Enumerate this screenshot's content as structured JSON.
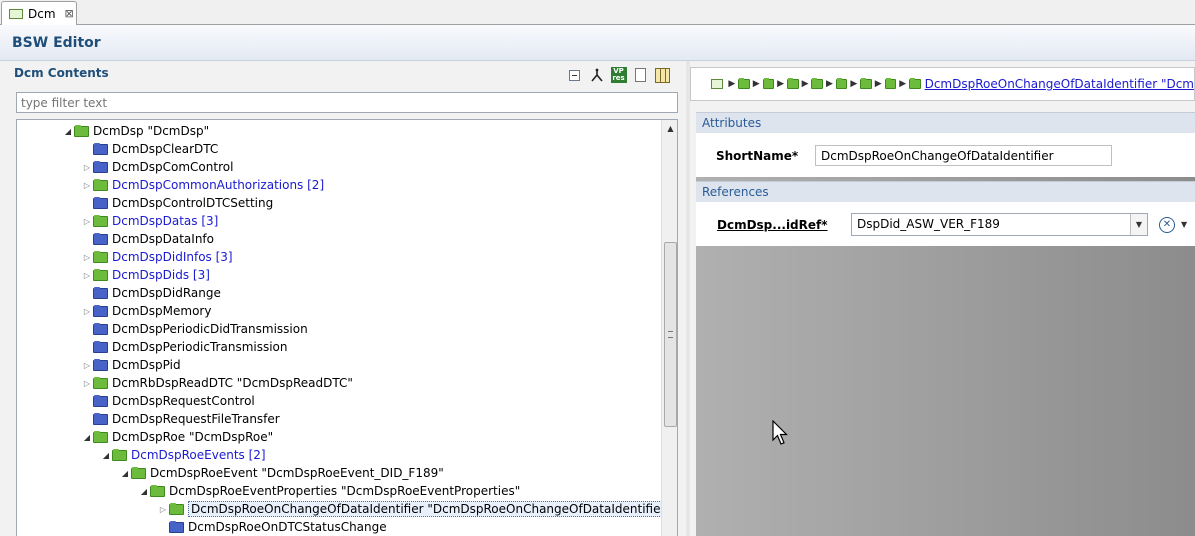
{
  "tab": {
    "label": "Dcm",
    "close": "⊠"
  },
  "editor": {
    "title": "BSW Editor"
  },
  "left": {
    "title": "Dcm Contents",
    "filter_placeholder": "type filter text"
  },
  "tree": [
    {
      "label": "DcmDsp \"DcmDsp\"",
      "depth": 0,
      "arrow": "expanded",
      "color": "green",
      "link": false
    },
    {
      "label": "DcmDspClearDTC",
      "depth": 1,
      "arrow": "none",
      "color": "blue",
      "link": false
    },
    {
      "label": "DcmDspComControl",
      "depth": 1,
      "arrow": "collapsed",
      "color": "blue",
      "link": false
    },
    {
      "label": "DcmDspCommonAuthorizations [2]",
      "depth": 1,
      "arrow": "collapsed",
      "color": "green",
      "link": true
    },
    {
      "label": "DcmDspControlDTCSetting",
      "depth": 1,
      "arrow": "none",
      "color": "blue",
      "link": false
    },
    {
      "label": "DcmDspDatas [3]",
      "depth": 1,
      "arrow": "collapsed",
      "color": "green",
      "link": true
    },
    {
      "label": "DcmDspDataInfo",
      "depth": 1,
      "arrow": "none",
      "color": "blue",
      "link": false
    },
    {
      "label": "DcmDspDidInfos [3]",
      "depth": 1,
      "arrow": "collapsed",
      "color": "green",
      "link": true
    },
    {
      "label": "DcmDspDids [3]",
      "depth": 1,
      "arrow": "collapsed",
      "color": "green",
      "link": true
    },
    {
      "label": "DcmDspDidRange",
      "depth": 1,
      "arrow": "none",
      "color": "blue",
      "link": false
    },
    {
      "label": "DcmDspMemory",
      "depth": 1,
      "arrow": "collapsed",
      "color": "blue",
      "link": false
    },
    {
      "label": "DcmDspPeriodicDidTransmission",
      "depth": 1,
      "arrow": "none",
      "color": "blue",
      "link": false
    },
    {
      "label": "DcmDspPeriodicTransmission",
      "depth": 1,
      "arrow": "none",
      "color": "blue",
      "link": false
    },
    {
      "label": "DcmDspPid",
      "depth": 1,
      "arrow": "collapsed",
      "color": "blue",
      "link": false
    },
    {
      "label": "DcmRbDspReadDTC \"DcmDspReadDTC\"",
      "depth": 1,
      "arrow": "collapsed",
      "color": "green",
      "link": false
    },
    {
      "label": "DcmDspRequestControl",
      "depth": 1,
      "arrow": "none",
      "color": "blue",
      "link": false
    },
    {
      "label": "DcmDspRequestFileTransfer",
      "depth": 1,
      "arrow": "none",
      "color": "blue",
      "link": false
    },
    {
      "label": "DcmDspRoe \"DcmDspRoe\"",
      "depth": 1,
      "arrow": "expanded",
      "color": "green",
      "link": false
    },
    {
      "label": "DcmDspRoeEvents [2]",
      "depth": 2,
      "arrow": "expanded",
      "color": "green",
      "link": true
    },
    {
      "label": "DcmDspRoeEvent \"DcmDspRoeEvent_DID_F189\"",
      "depth": 3,
      "arrow": "expanded",
      "color": "green",
      "link": false
    },
    {
      "label": "DcmDspRoeEventProperties \"DcmDspRoeEventProperties\"",
      "depth": 4,
      "arrow": "expanded",
      "color": "green",
      "link": false
    },
    {
      "label": "DcmDspRoeOnChangeOfDataIdentifier \"DcmDspRoeOnChangeOfDataIdentifier\"",
      "depth": 5,
      "arrow": "collapsed",
      "color": "green",
      "link": false,
      "selected": true
    },
    {
      "label": "DcmDspRoeOnDTCStatusChange",
      "depth": 5,
      "arrow": "none",
      "color": "blue",
      "link": false
    }
  ],
  "breadcrumb": {
    "folder_count": 8,
    "link": "DcmDspRoeOnChangeOfDataIdentifier \"Dcm"
  },
  "attributes": {
    "header": "Attributes",
    "shortname_label": "ShortName*",
    "shortname_value": "DcmDspRoeOnChangeOfDataIdentifier"
  },
  "references": {
    "header": "References",
    "ref_label": "DcmDsp...idRef*",
    "ref_value": "DspDid_ASW_VER_F189"
  },
  "icons": {
    "tab": "dcm-module-icon",
    "collapse_all": "collapse-all-icon",
    "link_editor": "link-with-editor-icon",
    "vp_res": "vp-res-icon",
    "document": "document-icon",
    "table": "table-view-icon"
  },
  "colors": {
    "title_blue": "#1f4e79",
    "link_blue": "#1a1ad0",
    "folder_green": "#6dbb3c",
    "folder_blue": "#4863c7",
    "section_header": "#dde4ee"
  }
}
